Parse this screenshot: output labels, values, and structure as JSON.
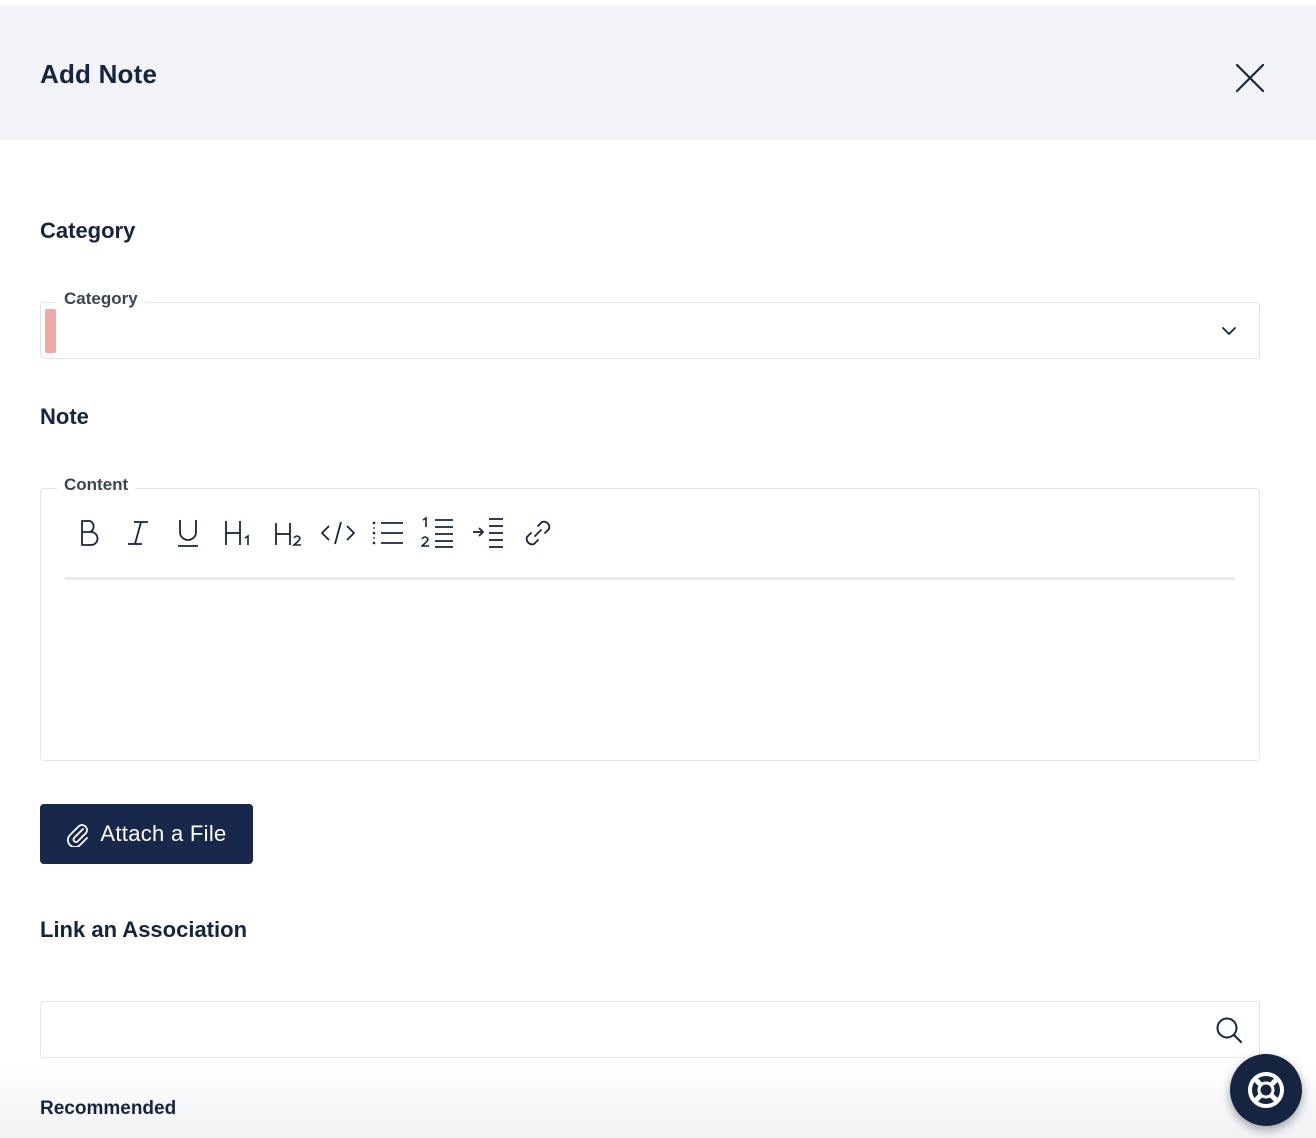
{
  "modal": {
    "title": "Add Note"
  },
  "category_section": {
    "heading": "Category",
    "field_label": "Category",
    "selected_value": ""
  },
  "note_section": {
    "heading": "Note",
    "editor_label": "Content",
    "editor_value": "",
    "toolbar": [
      {
        "name": "bold-button",
        "icon": "bold-icon"
      },
      {
        "name": "italic-button",
        "icon": "italic-icon"
      },
      {
        "name": "underline-button",
        "icon": "underline-icon"
      },
      {
        "name": "heading-1-button",
        "icon": "heading-1-icon"
      },
      {
        "name": "heading-2-button",
        "icon": "heading-2-icon"
      },
      {
        "name": "code-button",
        "icon": "code-icon"
      },
      {
        "name": "bullet-list-button",
        "icon": "bullet-list-icon"
      },
      {
        "name": "numbered-list-button",
        "icon": "numbered-list-icon"
      },
      {
        "name": "indent-button",
        "icon": "indent-icon"
      },
      {
        "name": "link-button",
        "icon": "link-icon"
      }
    ]
  },
  "attach": {
    "label": "Attach a File",
    "icon": "paperclip-icon"
  },
  "association_section": {
    "heading": "Link an Association",
    "search_placeholder": "",
    "search_value": ""
  },
  "recommended": {
    "heading": "Recommended"
  },
  "colors": {
    "header_bg": "#f3f4f7",
    "primary": "#17284a",
    "text": "#16253f",
    "required_indicator": "#f2a7a7"
  }
}
